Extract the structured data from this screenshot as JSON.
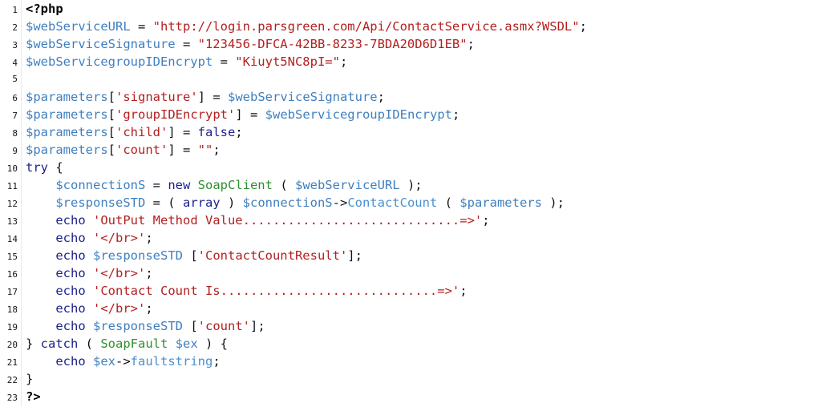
{
  "document": {
    "kind": "php-code-listing",
    "language": "PHP",
    "background_color": "#ffffff",
    "gutter_border_color": "#e9e9ef",
    "total_lines": 23,
    "colors": {
      "tag": "#000000",
      "variable": "#3f7fbf",
      "keyword": "#1b1f8a",
      "string": "#b3201f",
      "class": "#2f8f2f",
      "method": "#4a8fd0",
      "property": "#4a8fd0",
      "punctuation": "#101018",
      "line_number": "#15161a"
    }
  },
  "lines": [
    {
      "n": "1",
      "tokens": [
        {
          "t": "tag",
          "s": "<?php"
        }
      ]
    },
    {
      "n": "2",
      "tokens": [
        {
          "t": "var",
          "s": "$webServiceURL"
        },
        {
          "t": "plain",
          "s": " = "
        },
        {
          "t": "str",
          "s": "\"http://login.parsgreen.com/Api/ContactService.asmx?WSDL\""
        },
        {
          "t": "punct",
          "s": ";"
        }
      ]
    },
    {
      "n": "3",
      "tokens": [
        {
          "t": "var",
          "s": "$webServiceSignature"
        },
        {
          "t": "plain",
          "s": " = "
        },
        {
          "t": "str",
          "s": "\"123456-DFCA-42BB-8233-7BDA20D6D1EB\""
        },
        {
          "t": "punct",
          "s": ";"
        }
      ]
    },
    {
      "n": "4",
      "tokens": [
        {
          "t": "var",
          "s": "$webServicegroupIDEncrypt"
        },
        {
          "t": "plain",
          "s": " = "
        },
        {
          "t": "str",
          "s": "\"Kiuyt5NC8pI=\""
        },
        {
          "t": "punct",
          "s": ";"
        }
      ]
    },
    {
      "n": "5",
      "tokens": []
    },
    {
      "n": "6",
      "tokens": [
        {
          "t": "var",
          "s": "$parameters"
        },
        {
          "t": "punct",
          "s": "["
        },
        {
          "t": "str",
          "s": "'signature'"
        },
        {
          "t": "punct",
          "s": "]"
        },
        {
          "t": "plain",
          "s": " = "
        },
        {
          "t": "var",
          "s": "$webServiceSignature"
        },
        {
          "t": "punct",
          "s": ";"
        }
      ]
    },
    {
      "n": "7",
      "tokens": [
        {
          "t": "var",
          "s": "$parameters"
        },
        {
          "t": "punct",
          "s": "["
        },
        {
          "t": "str",
          "s": "'groupIDEncrypt'"
        },
        {
          "t": "punct",
          "s": "]"
        },
        {
          "t": "plain",
          "s": " = "
        },
        {
          "t": "var",
          "s": "$webServicegroupIDEncrypt"
        },
        {
          "t": "punct",
          "s": ";"
        }
      ]
    },
    {
      "n": "8",
      "tokens": [
        {
          "t": "var",
          "s": "$parameters"
        },
        {
          "t": "punct",
          "s": "["
        },
        {
          "t": "str",
          "s": "'child'"
        },
        {
          "t": "punct",
          "s": "]"
        },
        {
          "t": "plain",
          "s": " = "
        },
        {
          "t": "kw",
          "s": "false"
        },
        {
          "t": "punct",
          "s": ";"
        }
      ]
    },
    {
      "n": "9",
      "tokens": [
        {
          "t": "var",
          "s": "$parameters"
        },
        {
          "t": "punct",
          "s": "["
        },
        {
          "t": "str",
          "s": "'count'"
        },
        {
          "t": "punct",
          "s": "]"
        },
        {
          "t": "plain",
          "s": " = "
        },
        {
          "t": "str",
          "s": "\"\""
        },
        {
          "t": "punct",
          "s": ";"
        }
      ]
    },
    {
      "n": "10",
      "tokens": [
        {
          "t": "kw",
          "s": "try"
        },
        {
          "t": "punct",
          "s": " {"
        }
      ]
    },
    {
      "n": "11",
      "tokens": [
        {
          "t": "plain",
          "s": "    "
        },
        {
          "t": "var",
          "s": "$connectionS"
        },
        {
          "t": "plain",
          "s": " = "
        },
        {
          "t": "kw",
          "s": "new"
        },
        {
          "t": "plain",
          "s": " "
        },
        {
          "t": "class",
          "s": "SoapClient"
        },
        {
          "t": "punct",
          "s": " ( "
        },
        {
          "t": "var",
          "s": "$webServiceURL"
        },
        {
          "t": "punct",
          "s": " );"
        }
      ]
    },
    {
      "n": "12",
      "tokens": [
        {
          "t": "plain",
          "s": "    "
        },
        {
          "t": "var",
          "s": "$responseSTD"
        },
        {
          "t": "plain",
          "s": " = ( "
        },
        {
          "t": "kw",
          "s": "array"
        },
        {
          "t": "plain",
          "s": " ) "
        },
        {
          "t": "var",
          "s": "$connectionS"
        },
        {
          "t": "punct",
          "s": "->"
        },
        {
          "t": "method",
          "s": "ContactCount"
        },
        {
          "t": "punct",
          "s": " ( "
        },
        {
          "t": "var",
          "s": "$parameters"
        },
        {
          "t": "punct",
          "s": " );"
        }
      ]
    },
    {
      "n": "13",
      "tokens": [
        {
          "t": "plain",
          "s": "    "
        },
        {
          "t": "kw",
          "s": "echo"
        },
        {
          "t": "plain",
          "s": " "
        },
        {
          "t": "str",
          "s": "'OutPut Method Value.............................=>'"
        },
        {
          "t": "punct",
          "s": ";"
        }
      ]
    },
    {
      "n": "14",
      "tokens": [
        {
          "t": "plain",
          "s": "    "
        },
        {
          "t": "kw",
          "s": "echo"
        },
        {
          "t": "plain",
          "s": " "
        },
        {
          "t": "str",
          "s": "'</br>'"
        },
        {
          "t": "punct",
          "s": ";"
        }
      ]
    },
    {
      "n": "15",
      "tokens": [
        {
          "t": "plain",
          "s": "    "
        },
        {
          "t": "kw",
          "s": "echo"
        },
        {
          "t": "plain",
          "s": " "
        },
        {
          "t": "var",
          "s": "$responseSTD"
        },
        {
          "t": "punct",
          "s": " ["
        },
        {
          "t": "str",
          "s": "'ContactCountResult'"
        },
        {
          "t": "punct",
          "s": "];"
        }
      ]
    },
    {
      "n": "16",
      "tokens": [
        {
          "t": "plain",
          "s": "    "
        },
        {
          "t": "kw",
          "s": "echo"
        },
        {
          "t": "plain",
          "s": " "
        },
        {
          "t": "str",
          "s": "'</br>'"
        },
        {
          "t": "punct",
          "s": ";"
        }
      ]
    },
    {
      "n": "17",
      "tokens": [
        {
          "t": "plain",
          "s": "    "
        },
        {
          "t": "kw",
          "s": "echo"
        },
        {
          "t": "plain",
          "s": " "
        },
        {
          "t": "str",
          "s": "'Contact Count Is.............................=>'"
        },
        {
          "t": "punct",
          "s": ";"
        }
      ]
    },
    {
      "n": "18",
      "tokens": [
        {
          "t": "plain",
          "s": "    "
        },
        {
          "t": "kw",
          "s": "echo"
        },
        {
          "t": "plain",
          "s": " "
        },
        {
          "t": "str",
          "s": "'</br>'"
        },
        {
          "t": "punct",
          "s": ";"
        }
      ]
    },
    {
      "n": "19",
      "tokens": [
        {
          "t": "plain",
          "s": "    "
        },
        {
          "t": "kw",
          "s": "echo"
        },
        {
          "t": "plain",
          "s": " "
        },
        {
          "t": "var",
          "s": "$responseSTD"
        },
        {
          "t": "punct",
          "s": " ["
        },
        {
          "t": "str",
          "s": "'count'"
        },
        {
          "t": "punct",
          "s": "];"
        }
      ]
    },
    {
      "n": "20",
      "tokens": [
        {
          "t": "punct",
          "s": "} "
        },
        {
          "t": "kw",
          "s": "catch"
        },
        {
          "t": "punct",
          "s": " ( "
        },
        {
          "t": "class",
          "s": "SoapFault"
        },
        {
          "t": "plain",
          "s": " "
        },
        {
          "t": "var",
          "s": "$ex"
        },
        {
          "t": "punct",
          "s": " ) {"
        }
      ]
    },
    {
      "n": "21",
      "tokens": [
        {
          "t": "plain",
          "s": "    "
        },
        {
          "t": "kw",
          "s": "echo"
        },
        {
          "t": "plain",
          "s": " "
        },
        {
          "t": "var",
          "s": "$ex"
        },
        {
          "t": "punct",
          "s": "->"
        },
        {
          "t": "prop",
          "s": "faultstring"
        },
        {
          "t": "punct",
          "s": ";"
        }
      ]
    },
    {
      "n": "22",
      "tokens": [
        {
          "t": "punct",
          "s": "}"
        }
      ]
    },
    {
      "n": "23",
      "tokens": [
        {
          "t": "tag",
          "s": "?>"
        }
      ]
    }
  ]
}
